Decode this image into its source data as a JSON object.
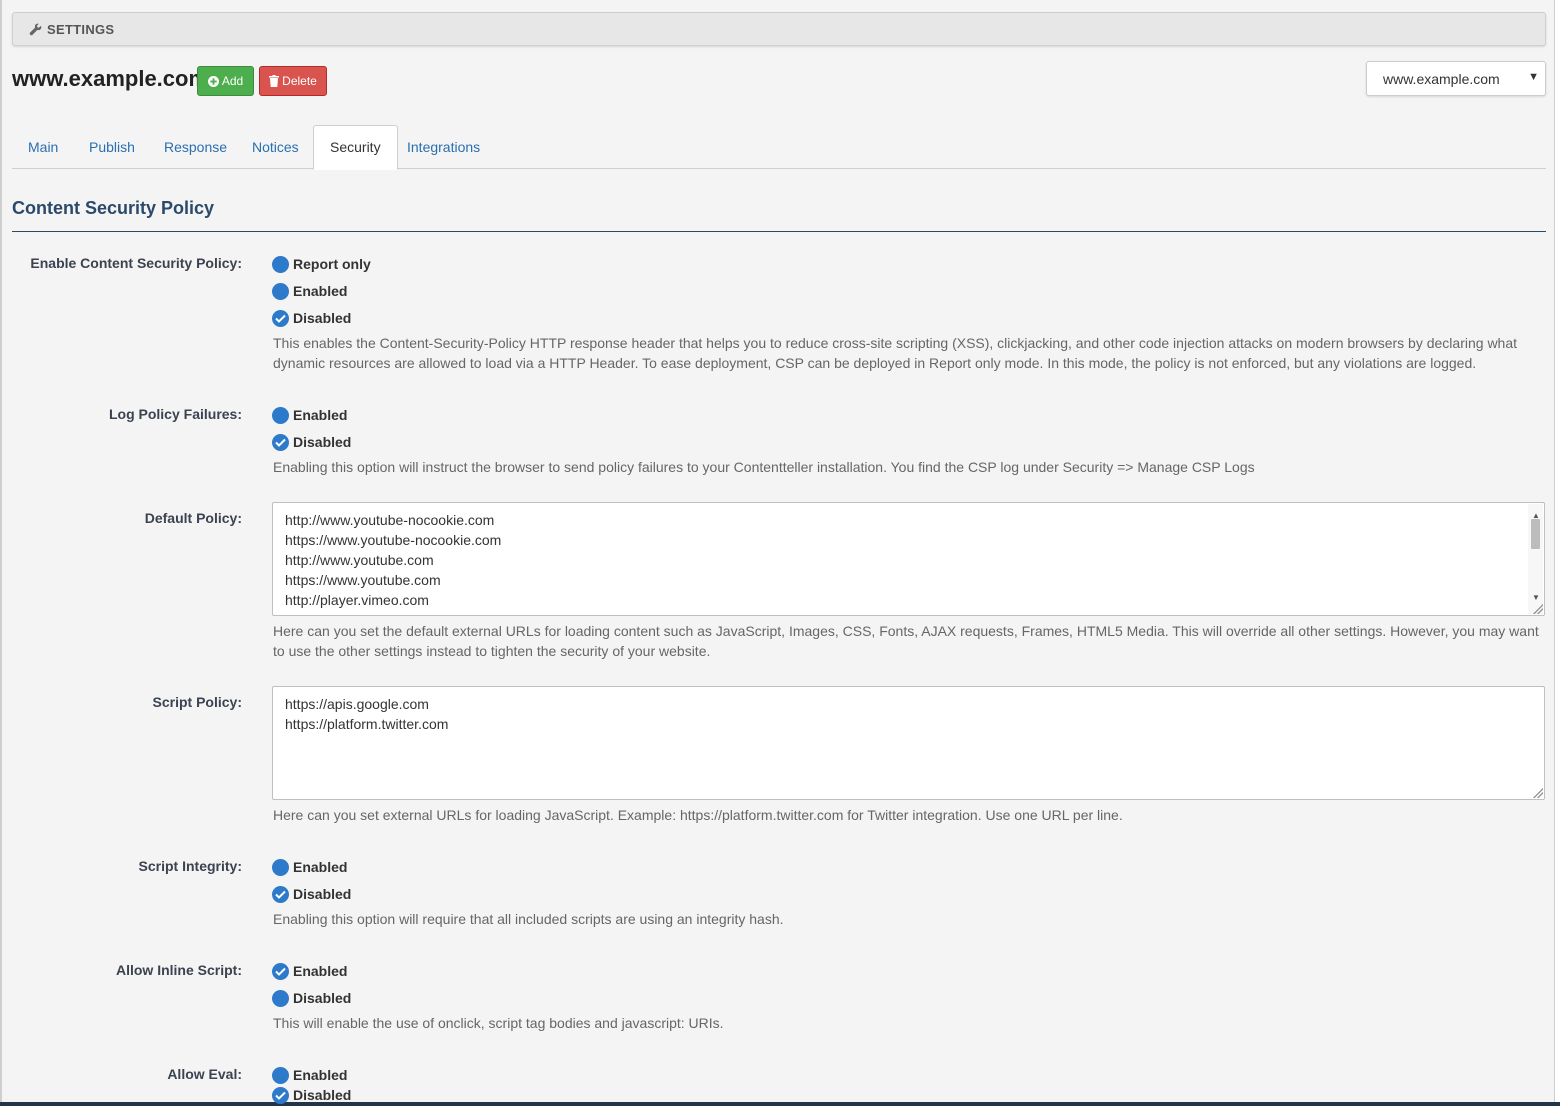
{
  "header": {
    "settings_label": "SETTINGS"
  },
  "site": {
    "title": "www.example.com",
    "add_label": "Add",
    "delete_label": "Delete",
    "selected": "www.example.com"
  },
  "tabs": [
    {
      "label": "Main"
    },
    {
      "label": "Publish"
    },
    {
      "label": "Response"
    },
    {
      "label": "Notices"
    },
    {
      "label": "Security",
      "active": true
    },
    {
      "label": "Integrations"
    }
  ],
  "section": {
    "title": "Content Security Policy"
  },
  "fields": {
    "csp": {
      "label": "Enable Content Security Policy:",
      "options": [
        "Report only",
        "Enabled",
        "Disabled"
      ],
      "selected": "Disabled",
      "help": "This enables the Content-Security-Policy HTTP response header that helps you to reduce cross-site scripting (XSS), clickjacking, and other code injection attacks on modern browsers by declaring what dynamic resources are allowed to load via a HTTP Header. To ease deployment, CSP can be deployed in Report only mode. In this mode, the policy is not enforced, but any violations are logged."
    },
    "log": {
      "label": "Log Policy Failures:",
      "options": [
        "Enabled",
        "Disabled"
      ],
      "selected": "Disabled",
      "help": "Enabling this option will instruct the browser to send policy failures to your Contentteller installation. You find the CSP log under Security => Manage CSP Logs"
    },
    "default_policy": {
      "label": "Default Policy:",
      "lines": [
        "http://www.youtube-nocookie.com",
        "https://www.youtube-nocookie.com",
        "http://www.youtube.com",
        "https://www.youtube.com",
        "http://player.vimeo.com"
      ],
      "help": "Here can you set the default external URLs for loading content such as JavaScript, Images, CSS, Fonts, AJAX requests, Frames, HTML5 Media. This will override all other settings. However, you may want to use the other settings instead to tighten the security of your website."
    },
    "script_policy": {
      "label": "Script Policy:",
      "lines": [
        "https://apis.google.com",
        "https://platform.twitter.com"
      ],
      "help": "Here can you set external URLs for loading JavaScript. Example: https://platform.twitter.com for Twitter integration. Use one URL per line."
    },
    "script_integrity": {
      "label": "Script Integrity:",
      "options": [
        "Enabled",
        "Disabled"
      ],
      "selected": "Disabled",
      "help": "Enabling this option will require that all included scripts are using an integrity hash."
    },
    "inline_script": {
      "label": "Allow Inline Script:",
      "options": [
        "Enabled",
        "Disabled"
      ],
      "selected": "Enabled",
      "help": "This will enable the use of onclick, script tag bodies and javascript: URIs."
    },
    "eval": {
      "label": "Allow Eval:",
      "options": [
        "Enabled",
        "Disabled"
      ],
      "selected": "Disabled"
    }
  },
  "colors": {
    "accent": "#2c7ac9",
    "heading": "#2b4a6a",
    "add": "#4cae4c",
    "delete": "#d9534f",
    "link": "#2a6fb0"
  }
}
